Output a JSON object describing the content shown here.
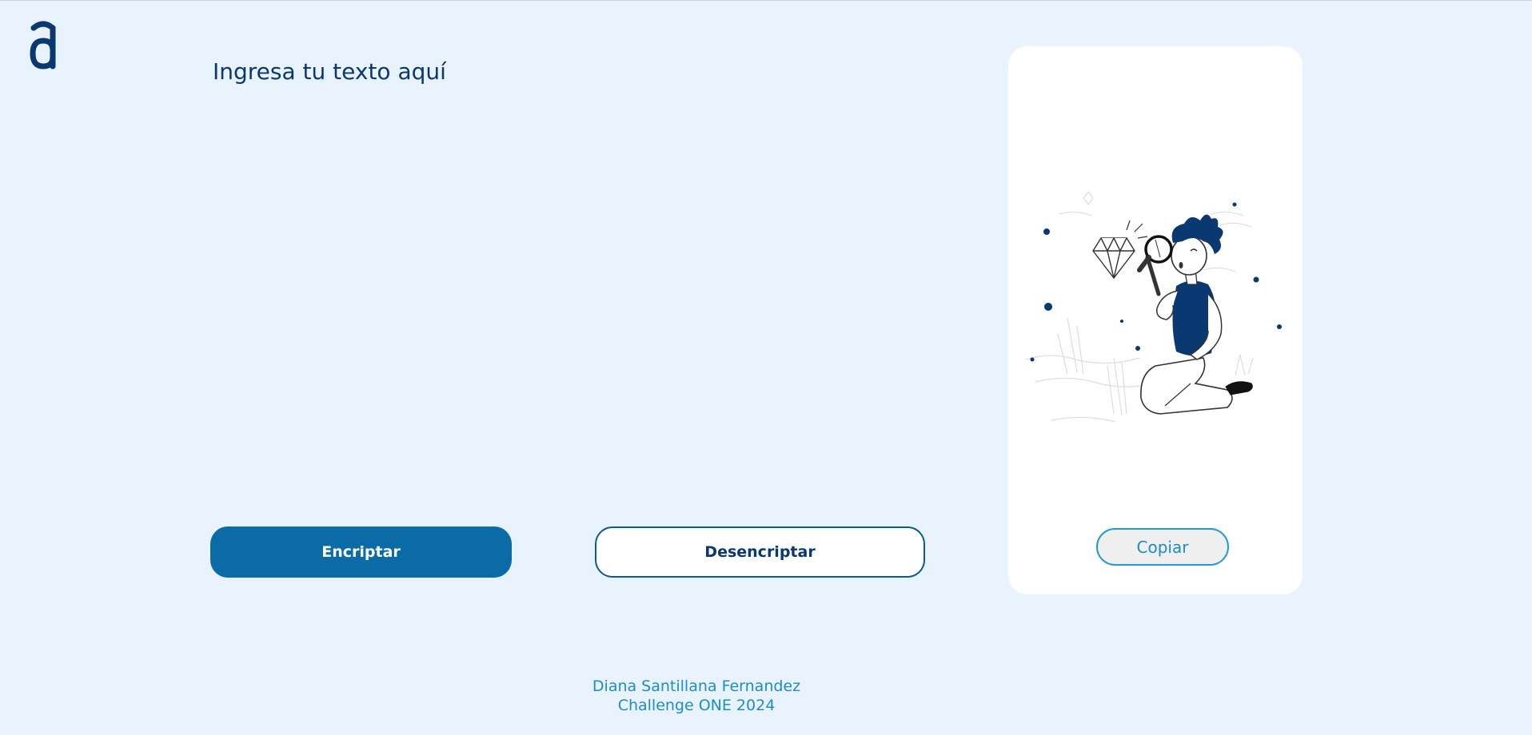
{
  "logo": {
    "icon": "alura-logo-icon",
    "color": "#0a3871"
  },
  "input": {
    "placeholder": "Ingresa tu texto aquí",
    "value": ""
  },
  "buttons": {
    "encrypt_label": "Encriptar",
    "decrypt_label": "Desencriptar",
    "copy_label": "Copiar"
  },
  "output_panel": {
    "illustration": "person-with-magnifying-glass-illustration"
  },
  "footer": {
    "author": "Diana Santillana Fernandez",
    "event": "Challenge ONE 2024"
  },
  "colors": {
    "background": "#e8f3fd",
    "primary": "#0a3871",
    "encrypt_button": "#0a6ba6",
    "accent": "#1d8cc7"
  }
}
